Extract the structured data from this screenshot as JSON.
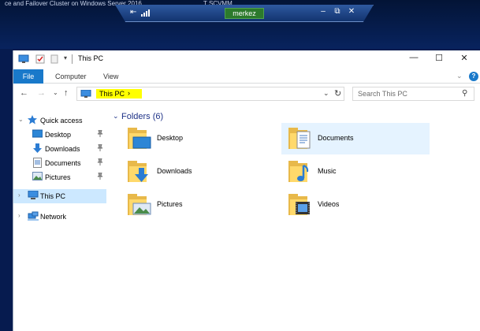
{
  "remote": {
    "caption_left": "ce and Failover Cluster on Windows Server 2016",
    "caption_right": "T   SCVMM",
    "host": "merkez",
    "controls": {
      "minimize": "–",
      "restore": "⧉",
      "close": "✕"
    },
    "pin_glyph": "⇤"
  },
  "window": {
    "title": "This PC",
    "controls": {
      "minimize": "—",
      "maximize": "☐",
      "close": "✕"
    },
    "qat_dropdown": "▾"
  },
  "ribbon": {
    "tabs": [
      {
        "label": "File"
      },
      {
        "label": "Computer"
      },
      {
        "label": "View"
      }
    ],
    "expand_glyph": "⌄",
    "help_glyph": "?"
  },
  "navigation": {
    "back": "←",
    "forward": "→",
    "recent": "⌄",
    "up": "↑",
    "address": {
      "location": "This PC",
      "separator": "›",
      "dropdown": "⌄",
      "refresh": "↻"
    },
    "search": {
      "placeholder": "Search This PC",
      "icon": "⚲"
    }
  },
  "nav_pane": {
    "items": [
      {
        "label": "Quick access",
        "icon": "star-icon",
        "expander": "⌄",
        "pinned": false
      },
      {
        "label": "Desktop",
        "icon": "desktop-icon",
        "pinned": true
      },
      {
        "label": "Downloads",
        "icon": "download-icon",
        "pinned": true
      },
      {
        "label": "Documents",
        "icon": "document-icon",
        "pinned": true
      },
      {
        "label": "Pictures",
        "icon": "picture-icon",
        "pinned": true
      },
      {
        "label": "This PC",
        "icon": "computer-icon",
        "expander": "›",
        "selected": true
      },
      {
        "label": "Network",
        "icon": "network-icon",
        "expander": "›"
      }
    ],
    "pin_glyph": "📌"
  },
  "content": {
    "group_title": "Folders (6)",
    "group_chevron": "⌄",
    "folders": [
      {
        "label": "Desktop",
        "icon": "desktop-folder-icon"
      },
      {
        "label": "Documents",
        "icon": "documents-folder-icon",
        "hovered": true
      },
      {
        "label": "Downloads",
        "icon": "downloads-folder-icon"
      },
      {
        "label": "Music",
        "icon": "music-folder-icon"
      },
      {
        "label": "Pictures",
        "icon": "pictures-folder-icon"
      },
      {
        "label": "Videos",
        "icon": "videos-folder-icon"
      }
    ]
  },
  "colors": {
    "accent": "#1979ca",
    "selection": "#cce8ff",
    "hover": "#e5f3ff",
    "highlight": "#ffff00",
    "group_title": "#1e3287",
    "folder": "#ffd96b"
  }
}
